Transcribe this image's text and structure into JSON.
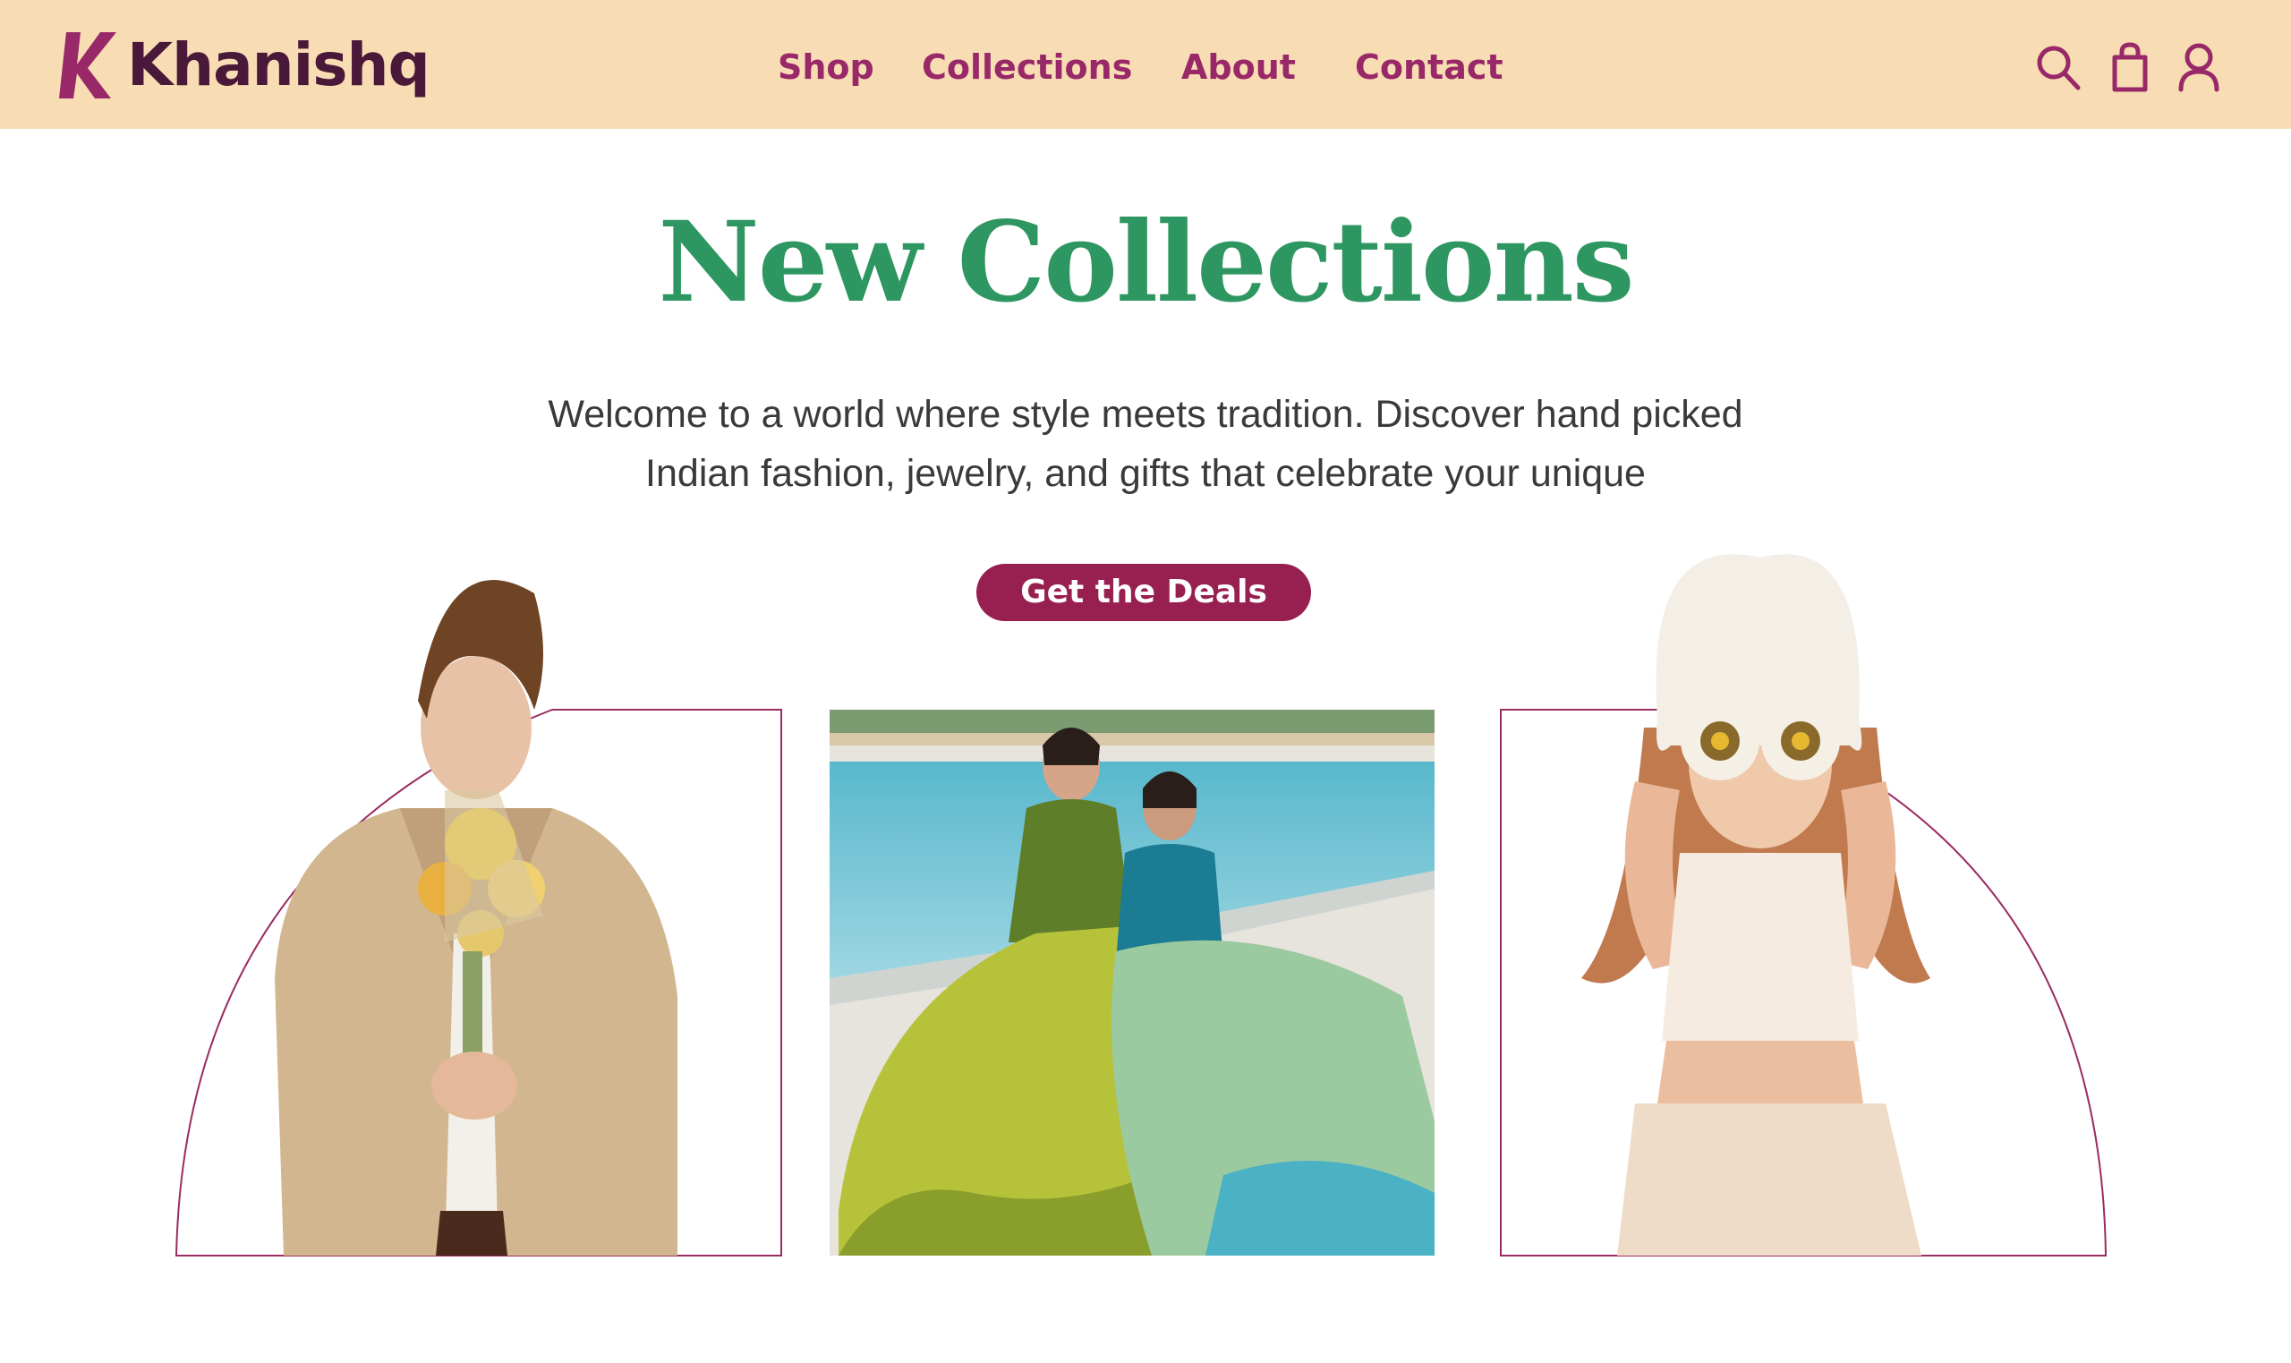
{
  "brand": {
    "name": "Khanishq",
    "logo_letter": "K"
  },
  "nav": {
    "items": [
      {
        "label": "Shop"
      },
      {
        "label": "Collections"
      },
      {
        "label": "About"
      },
      {
        "label": "Contact"
      }
    ]
  },
  "header_icons": [
    "search-icon",
    "shopping-bag-icon",
    "user-icon"
  ],
  "hero": {
    "title": "New Collections",
    "subtitle": "Welcome to a world where style meets tradition. Discover hand picked Indian fashion, jewelry, and gifts that celebrate your unique",
    "cta_label": "Get the Deals"
  },
  "colors": {
    "header_bg": "#f8dcb4",
    "brand_dark": "#4a1838",
    "brand_accent": "#982868",
    "title_green": "#2e9660",
    "cta_bg": "#982050",
    "card_outline": "#9a2c62"
  }
}
